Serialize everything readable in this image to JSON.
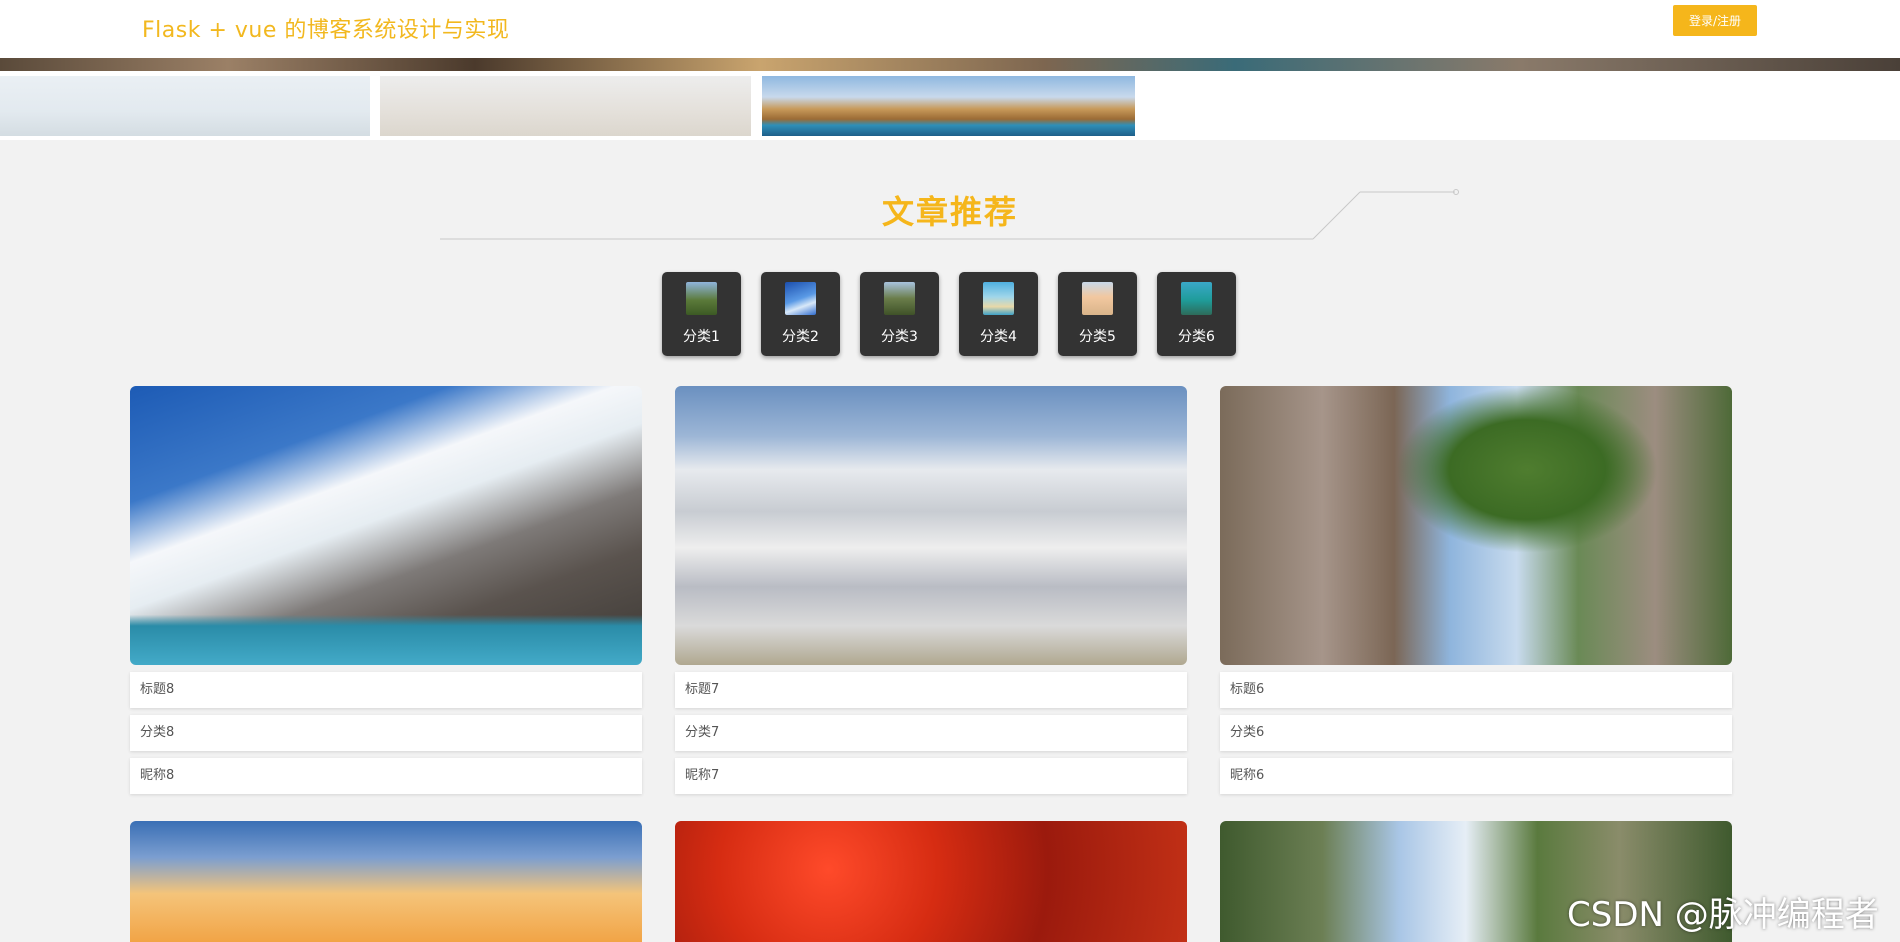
{
  "header": {
    "title": "Flask + vue 的博客系统设计与实现",
    "login_label": "登录/注册"
  },
  "section": {
    "title": "文章推荐"
  },
  "categories": [
    {
      "label": "分类1",
      "color": "#5b7a3a"
    },
    {
      "label": "分类2",
      "color": "#2f6ccf"
    },
    {
      "label": "分类3",
      "color": "#6a7d4a"
    },
    {
      "label": "分类4",
      "color": "#3fa2c8"
    },
    {
      "label": "分类5",
      "color": "#d9b48a"
    },
    {
      "label": "分类6",
      "color": "#1f9c9a"
    }
  ],
  "cards": [
    {
      "title": "标题8",
      "category": "分类8",
      "nickname": "昵称8"
    },
    {
      "title": "标题7",
      "category": "分类7",
      "nickname": "昵称7"
    },
    {
      "title": "标题6",
      "category": "分类6",
      "nickname": "昵称6"
    }
  ],
  "accent": "#f5b61b",
  "watermark": "CSDN @脉冲编程者"
}
